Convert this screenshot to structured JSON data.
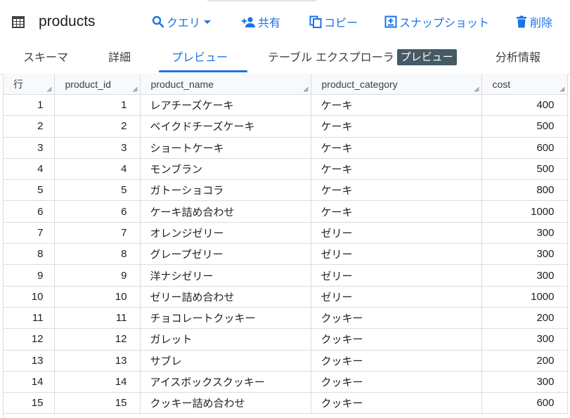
{
  "header": {
    "title": "products",
    "actions": {
      "query": "クエリ",
      "share": "共有",
      "copy": "コピー",
      "snapshot": "スナップショット",
      "delete": "削除"
    }
  },
  "tabs": {
    "schema": "スキーマ",
    "details": "詳細",
    "preview": "プレビュー",
    "explorer": "テーブル エクスプローラ",
    "explorer_badge": "プレビュー",
    "insights": "分析情報",
    "active": "preview"
  },
  "table": {
    "columns": [
      "行",
      "product_id",
      "product_name",
      "product_category",
      "cost"
    ],
    "rows": [
      [
        "1",
        "1",
        "レアチーズケーキ",
        "ケーキ",
        "400"
      ],
      [
        "2",
        "2",
        "ベイクドチーズケーキ",
        "ケーキ",
        "500"
      ],
      [
        "3",
        "3",
        "ショートケーキ",
        "ケーキ",
        "600"
      ],
      [
        "4",
        "4",
        "モンブラン",
        "ケーキ",
        "500"
      ],
      [
        "5",
        "5",
        "ガトーショコラ",
        "ケーキ",
        "800"
      ],
      [
        "6",
        "6",
        "ケーキ詰め合わせ",
        "ケーキ",
        "1000"
      ],
      [
        "7",
        "7",
        "オレンジゼリー",
        "ゼリー",
        "300"
      ],
      [
        "8",
        "8",
        "グレープゼリー",
        "ゼリー",
        "300"
      ],
      [
        "9",
        "9",
        "洋ナシゼリー",
        "ゼリー",
        "300"
      ],
      [
        "10",
        "10",
        "ゼリー詰め合わせ",
        "ゼリー",
        "1000"
      ],
      [
        "11",
        "11",
        "チョコレートクッキー",
        "クッキー",
        "200"
      ],
      [
        "12",
        "12",
        "ガレット",
        "クッキー",
        "300"
      ],
      [
        "13",
        "13",
        "サブレ",
        "クッキー",
        "200"
      ],
      [
        "14",
        "14",
        "アイスボックスクッキー",
        "クッキー",
        "300"
      ],
      [
        "15",
        "15",
        "クッキー詰め合わせ",
        "クッキー",
        "600"
      ]
    ]
  },
  "colors": {
    "accent": "#1a73e8",
    "badge": "#455a64",
    "grid_border": "#dadce0",
    "header_bg": "#f8f9fa"
  }
}
